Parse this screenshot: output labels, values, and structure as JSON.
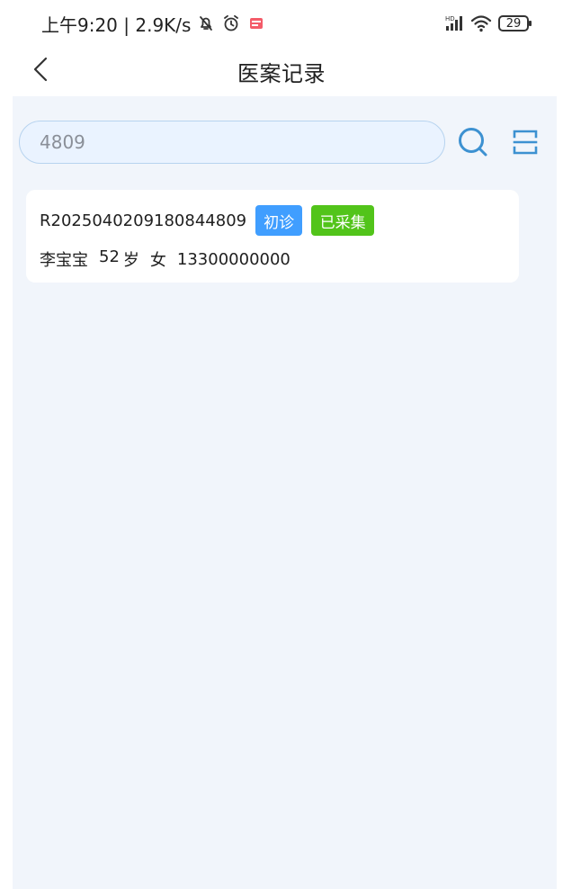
{
  "status_bar": {
    "time_speed": "上午9:20 | 2.9K/s",
    "battery": "29",
    "icons": [
      "mute-bell-icon",
      "alarm-icon",
      "app-badge-icon",
      "hd-signal-icon",
      "wifi-icon",
      "battery-icon"
    ]
  },
  "header": {
    "title": "医案记录",
    "back_icon": "chevron-left-icon"
  },
  "search": {
    "value": "4809",
    "placeholder": "",
    "search_icon": "search-icon",
    "scan_icon": "scan-icon"
  },
  "records": [
    {
      "record_id": "R2025040209180844809",
      "visit_tag": "初诊",
      "collection_tag": "已采集",
      "patient_name": "李宝宝",
      "age": "52",
      "age_unit": "岁",
      "gender": "女",
      "phone": "13300000000"
    }
  ],
  "colors": {
    "background": "#f1f5fb",
    "search_fill": "#eaf3ff",
    "search_border": "#b7d3ef",
    "accent_blue": "#409eff",
    "success_green": "#52c41a",
    "icon_blue": "#3d91d1"
  }
}
